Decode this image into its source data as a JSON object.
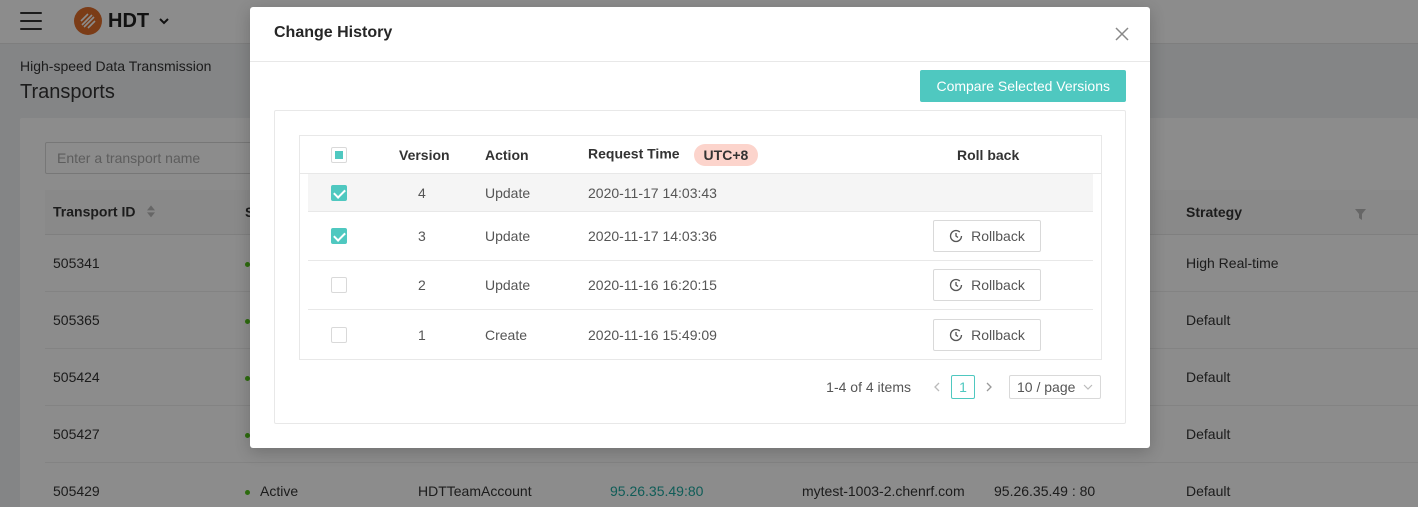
{
  "header": {
    "app_name": "HDT"
  },
  "page": {
    "breadcrumb": "High-speed Data Transmission",
    "title": "Transports",
    "search_placeholder": "Enter a transport name"
  },
  "table": {
    "columns": {
      "transport_id": "Transport ID",
      "status": "S",
      "strategy": "Strategy"
    },
    "rows": [
      {
        "id": "505341",
        "strategy": "High Real-time"
      },
      {
        "id": "505365",
        "strategy": "Default"
      },
      {
        "id": "505424",
        "strategy": "Default"
      },
      {
        "id": "505427",
        "strategy": "Default"
      },
      {
        "id": "505429",
        "status": "Active",
        "account": "HDTTeamAccount",
        "ip_port": "95.26.35.49:80",
        "domain": "mytest-1003-2.chenrf.com",
        "address": "95.26.35.49 : 80",
        "strategy": "Default"
      }
    ]
  },
  "modal": {
    "title": "Change History",
    "compare_label": "Compare Selected Versions",
    "columns": {
      "version": "Version",
      "action": "Action",
      "request_time": "Request Time",
      "timezone": "UTC+8",
      "rollback": "Roll back"
    },
    "versions": [
      {
        "version": "4",
        "action": "Update",
        "time": "2020-11-17 14:03:43",
        "checked": true
      },
      {
        "version": "3",
        "action": "Update",
        "time": "2020-11-17 14:03:36",
        "checked": true,
        "rollback": "Rollback"
      },
      {
        "version": "2",
        "action": "Update",
        "time": "2020-11-16 16:20:15",
        "checked": false,
        "rollback": "Rollback"
      },
      {
        "version": "1",
        "action": "Create",
        "time": "2020-11-16 15:49:09",
        "checked": false,
        "rollback": "Rollback"
      }
    ],
    "pagination": {
      "total": "1-4 of 4 items",
      "current": "1",
      "page_size": "10 / page"
    }
  },
  "colors": {
    "accent": "#4fc8c0",
    "badge": "#fcd4cc",
    "status_active": "#52c41a",
    "logo": "#e06d2b"
  },
  "icons": [
    "menu-icon",
    "logo-icon",
    "chevron-down-icon",
    "sort-icon",
    "filter-icon",
    "close-icon",
    "history-icon",
    "chevron-left-icon",
    "chevron-right-icon"
  ]
}
